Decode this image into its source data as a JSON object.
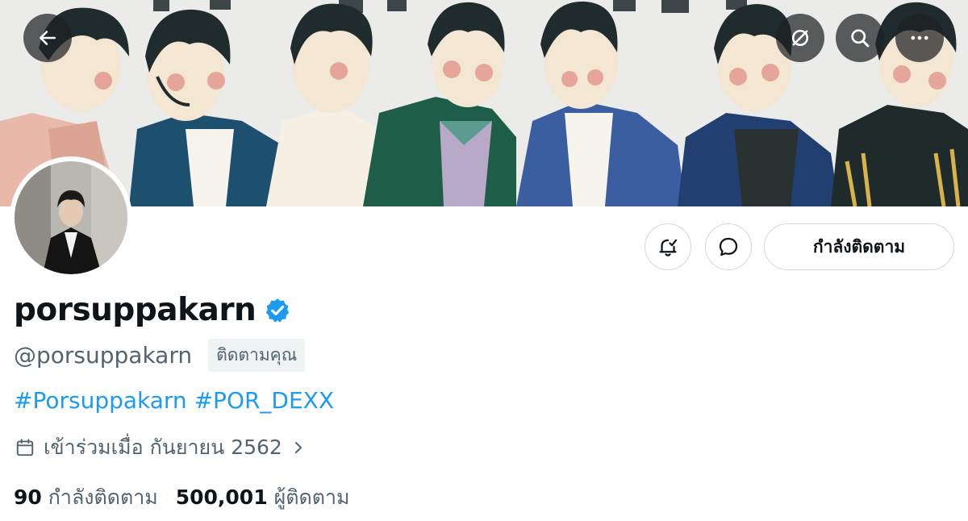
{
  "header": {
    "back_icon": "arrow-left-icon",
    "translate_icon": "eye-slash-icon",
    "search_icon": "search-icon",
    "more_icon": "more-dots-icon"
  },
  "profile": {
    "display_name": "porsuppakarn",
    "verified": true,
    "handle": "@porsuppakarn",
    "follows_you_badge": "ติดตามคุณ",
    "bio_tags": [
      "#Porsuppakarn",
      "#POR_DEXX"
    ],
    "joined": "เข้าร่วมเมื่อ กันยายน 2562",
    "following_count": "90",
    "following_label": "กำลังติดตาม",
    "followers_count": "500,001",
    "followers_label": "ผู้ติดตาม"
  },
  "actions": {
    "notify_icon": "bell-check-icon",
    "message_icon": "message-bubble-icon",
    "follow_button_label": "กำลังติดตาม"
  },
  "colors": {
    "accent": "#1d9bf0",
    "text_primary": "#0f1419",
    "text_secondary": "#536471",
    "border": "#cfd9de"
  }
}
